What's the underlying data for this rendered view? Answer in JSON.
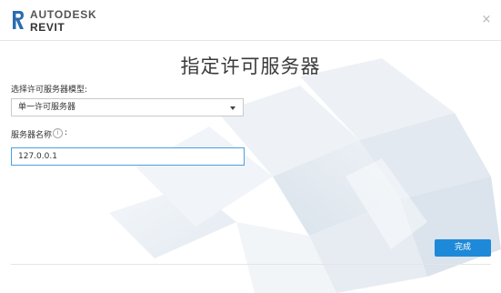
{
  "header": {
    "brand_company": "AUTODESK",
    "brand_product": "REVIT",
    "logo_color": "#2b6cb0",
    "close_label": "×"
  },
  "main": {
    "title": "指定许可服务器",
    "server_model_label": "选择许可服务器模型:",
    "server_model_value": "单一许可服务器",
    "server_name_label": "服务器名称",
    "server_name_colon": ":",
    "info_icon_glyph": "i",
    "server_name_value": "127.0.0.1"
  },
  "footer": {
    "done_label": "完成",
    "button_color": "#1d89d8"
  }
}
